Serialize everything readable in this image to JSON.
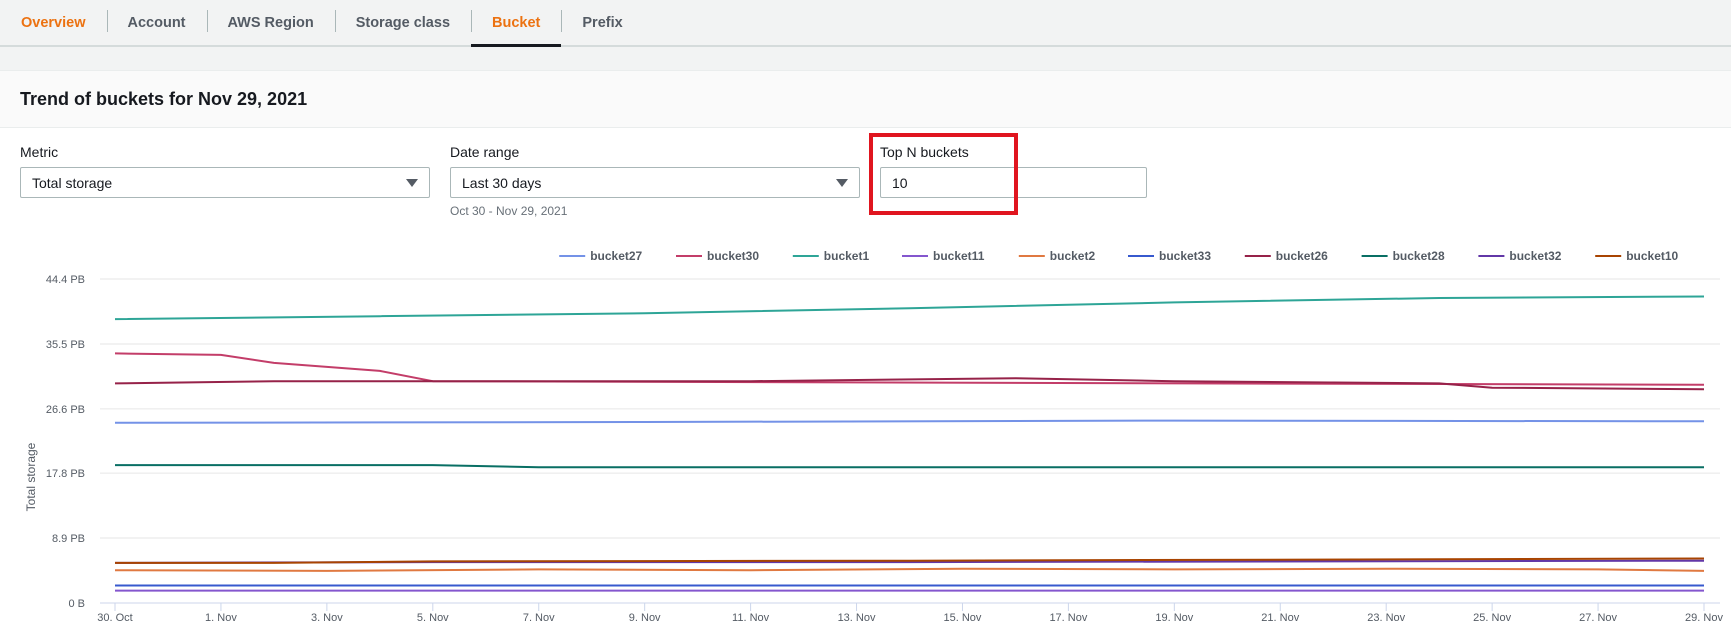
{
  "tabs": [
    {
      "label": "Overview",
      "active": false
    },
    {
      "label": "Account",
      "active": false
    },
    {
      "label": "AWS Region",
      "active": false
    },
    {
      "label": "Storage class",
      "active": false
    },
    {
      "label": "Bucket",
      "active": true
    },
    {
      "label": "Prefix",
      "active": false
    }
  ],
  "panel": {
    "title": "Trend of buckets for Nov 29, 2021"
  },
  "filters": {
    "metric": {
      "label": "Metric",
      "value": "Total storage"
    },
    "date_range": {
      "label": "Date range",
      "value": "Last 30 days",
      "hint": "Oct 30 - Nov 29, 2021"
    },
    "top_n": {
      "label": "Top N buckets",
      "value": "10"
    }
  },
  "chart_data": {
    "type": "line",
    "title": "",
    "xlabel": "",
    "ylabel": "Total storage",
    "y_ticks": [
      "0 B",
      "8.9 PB",
      "17.8 PB",
      "26.6 PB",
      "35.5 PB",
      "44.4 PB"
    ],
    "y_tick_values": [
      0,
      8.9,
      17.8,
      26.6,
      35.5,
      44.4
    ],
    "ylim": [
      0,
      44.4
    ],
    "x_ticks": [
      "30. Oct",
      "1. Nov",
      "3. Nov",
      "5. Nov",
      "7. Nov",
      "9. Nov",
      "11. Nov",
      "13. Nov",
      "15. Nov",
      "17. Nov",
      "19. Nov",
      "21. Nov",
      "23. Nov",
      "25. Nov",
      "27. Nov",
      "29. Nov"
    ],
    "x_days": 30,
    "grid": true,
    "legend_position": "top-right",
    "series": [
      {
        "name": "bucket27",
        "color": "#7492e7",
        "points": [
          [
            0,
            24.7
          ],
          [
            10,
            24.8
          ],
          [
            20,
            25.0
          ],
          [
            30,
            24.9
          ]
        ]
      },
      {
        "name": "bucket30",
        "color": "#c33d69",
        "points": [
          [
            0,
            34.2
          ],
          [
            2,
            34.0
          ],
          [
            3,
            32.9
          ],
          [
            5,
            31.8
          ],
          [
            6,
            30.4
          ],
          [
            30,
            29.9
          ]
        ]
      },
      {
        "name": "bucket1",
        "color": "#2ea597",
        "points": [
          [
            0,
            38.9
          ],
          [
            5,
            39.3
          ],
          [
            10,
            39.7
          ],
          [
            15,
            40.4
          ],
          [
            20,
            41.2
          ],
          [
            25,
            41.8
          ],
          [
            30,
            42.0
          ]
        ]
      },
      {
        "name": "bucket11",
        "color": "#8456ce",
        "points": [
          [
            0,
            1.7
          ],
          [
            30,
            1.7
          ]
        ]
      },
      {
        "name": "bucket2",
        "color": "#e07941",
        "points": [
          [
            0,
            4.5
          ],
          [
            4,
            4.4
          ],
          [
            8,
            4.6
          ],
          [
            12,
            4.5
          ],
          [
            16,
            4.7
          ],
          [
            20,
            4.6
          ],
          [
            24,
            4.7
          ],
          [
            28,
            4.6
          ],
          [
            30,
            4.4
          ]
        ]
      },
      {
        "name": "bucket33",
        "color": "#3759ce",
        "points": [
          [
            0,
            2.4
          ],
          [
            30,
            2.4
          ]
        ]
      },
      {
        "name": "bucket26",
        "color": "#962249",
        "points": [
          [
            0,
            30.1
          ],
          [
            3,
            30.4
          ],
          [
            6,
            30.4
          ],
          [
            12,
            30.4
          ],
          [
            17,
            30.8
          ],
          [
            20,
            30.4
          ],
          [
            25,
            30.1
          ],
          [
            26,
            29.5
          ],
          [
            30,
            29.3
          ]
        ]
      },
      {
        "name": "bucket28",
        "color": "#096f64",
        "points": [
          [
            0,
            18.9
          ],
          [
            6,
            18.9
          ],
          [
            8,
            18.6
          ],
          [
            30,
            18.6
          ]
        ]
      },
      {
        "name": "bucket32",
        "color": "#6237a7",
        "points": [
          [
            0,
            5.5
          ],
          [
            6,
            5.6
          ],
          [
            15,
            5.6
          ],
          [
            30,
            5.8
          ]
        ]
      },
      {
        "name": "bucket10",
        "color": "#a84401",
        "points": [
          [
            0,
            5.5
          ],
          [
            3,
            5.5
          ],
          [
            6,
            5.7
          ],
          [
            15,
            5.8
          ],
          [
            30,
            6.1
          ]
        ]
      }
    ]
  }
}
